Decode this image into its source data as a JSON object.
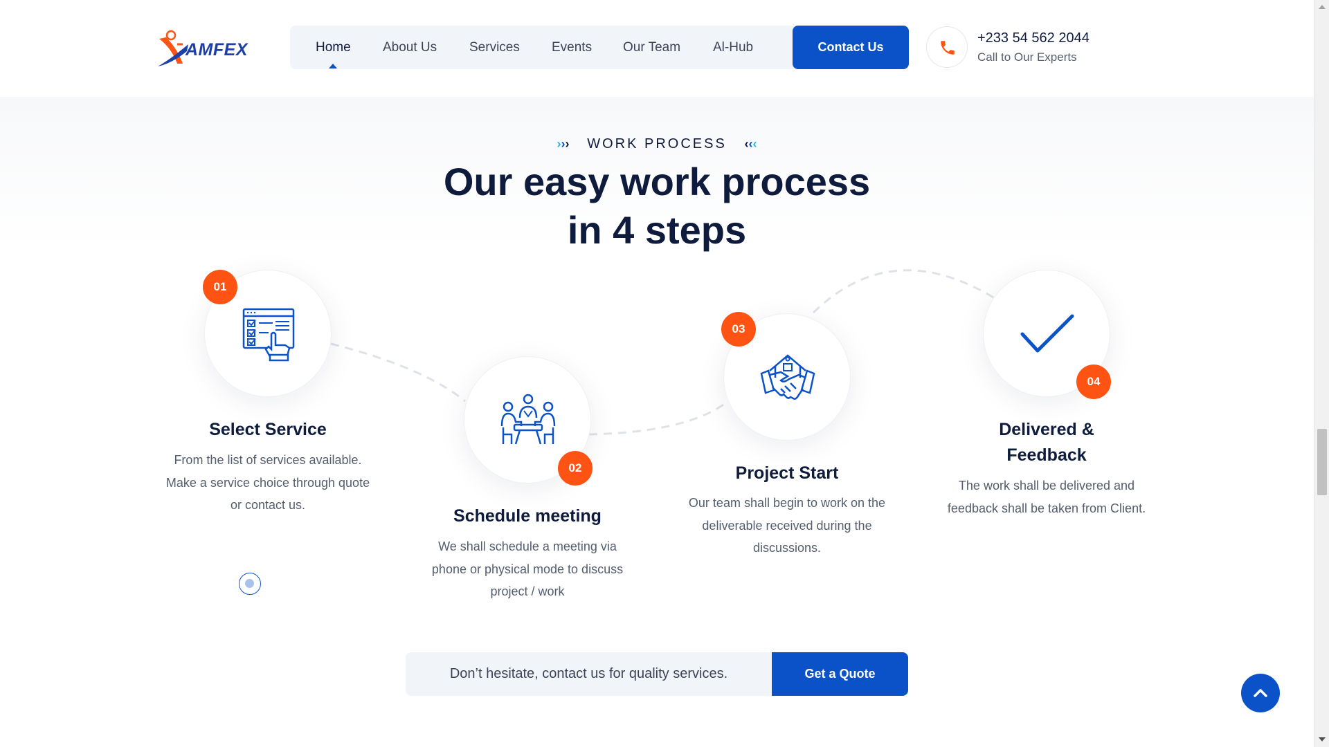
{
  "header": {
    "logo_text": "AMFEX",
    "nav": [
      {
        "label": "Home",
        "active": true
      },
      {
        "label": "About Us"
      },
      {
        "label": "Services"
      },
      {
        "label": "Events"
      },
      {
        "label": "Our Team"
      },
      {
        "label": "Al-Hub"
      }
    ],
    "contact_button": "Contact Us",
    "phone_number": "+233 54 562 2044",
    "phone_caption": "Call to Our Experts"
  },
  "section": {
    "eyebrow": "WORK PROCESS",
    "headline_line1": "Our easy work process",
    "headline_line2": "in 4 steps",
    "steps": [
      {
        "number": "01",
        "title": "Select Service",
        "description": "From the list of services available. Make a service choice through quote or contact us.",
        "icon": "checklist-icon"
      },
      {
        "number": "02",
        "title": "Schedule meeting",
        "description": "We shall schedule a meeting via phone or physical mode to discuss project / work",
        "icon": "meeting-icon"
      },
      {
        "number": "03",
        "title": "Project Start",
        "description": "Our team shall begin to work on the deliverable received during the discussions.",
        "icon": "handshake-icon"
      },
      {
        "number": "04",
        "title": "Delivered & Feedback",
        "description": "The work shall be delivered and feedback shall be taken from Client.",
        "icon": "checkmark-icon"
      }
    ]
  },
  "cta": {
    "text": "Don’t hesitate, contact us for quality services.",
    "button": "Get a Quote"
  },
  "colors": {
    "primary": "#0b52c9",
    "accent": "#ff5313",
    "heading": "#0e1b3d"
  }
}
